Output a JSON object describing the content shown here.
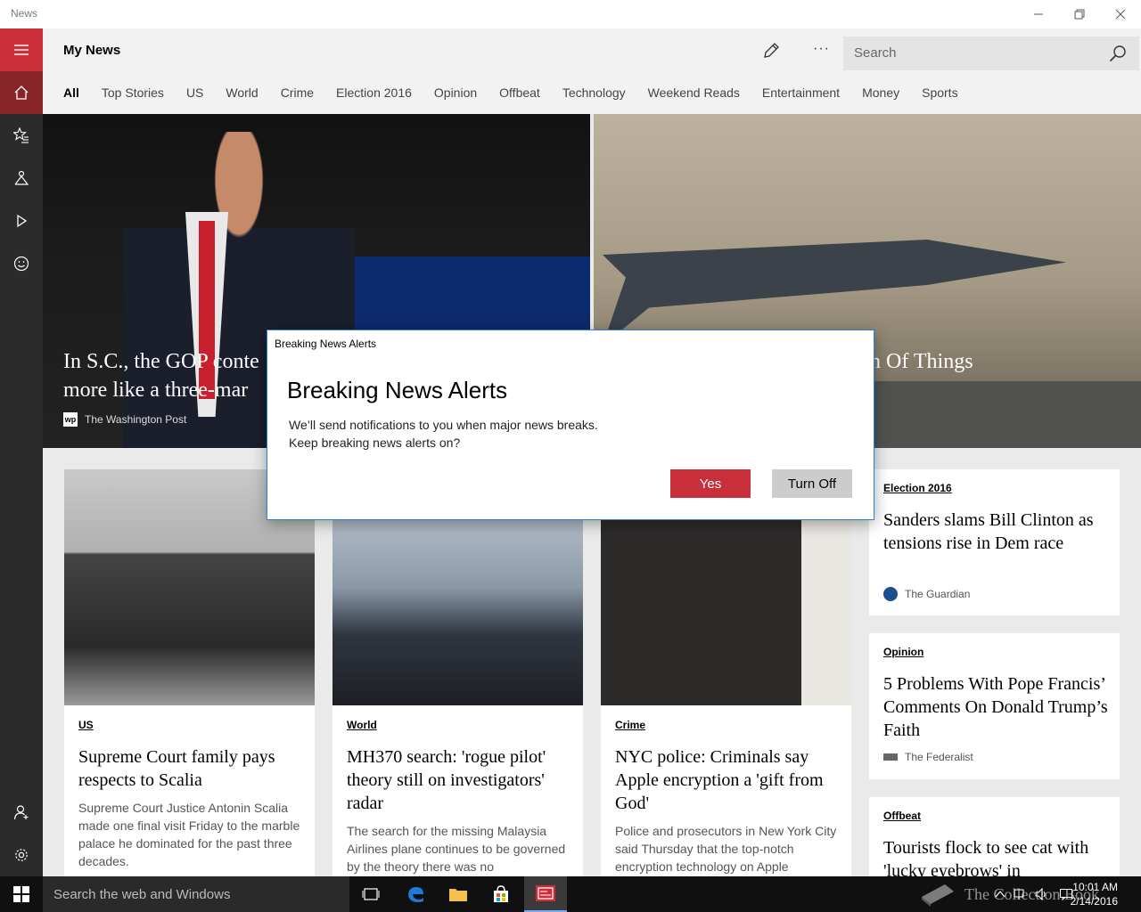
{
  "window": {
    "title": "News"
  },
  "header": {
    "title": "My News",
    "search_placeholder": "Search"
  },
  "tabs": [
    {
      "label": "All",
      "active": true
    },
    {
      "label": "Top Stories"
    },
    {
      "label": "US"
    },
    {
      "label": "World"
    },
    {
      "label": "Crime"
    },
    {
      "label": "Election 2016"
    },
    {
      "label": "Opinion"
    },
    {
      "label": "Offbeat"
    },
    {
      "label": "Technology"
    },
    {
      "label": "Weekend Reads"
    },
    {
      "label": "Entertainment"
    },
    {
      "label": "Money"
    },
    {
      "label": "Sports"
    }
  ],
  "rail": {
    "items": [
      "hamburger-icon",
      "home-icon",
      "favorites-icon",
      "interests-icon",
      "video-icon",
      "smiley-icon",
      "account-icon",
      "settings-icon"
    ]
  },
  "hero": {
    "left_headline_1": "In S.C., the GOP conte",
    "left_headline_2": "more like a three-mar",
    "left_source": "The Washington Post",
    "left_source_logo": "wp",
    "right_headline": "n Of Things"
  },
  "cards": {
    "us": {
      "category": "US",
      "headline": "Supreme Court family pays respects to Scalia",
      "summary": "Supreme Court Justice Antonin Scalia made one final visit Friday to the marble palace he dominated for the past three decades."
    },
    "world": {
      "category": "World",
      "headline": "MH370 search: 'rogue pilot' theory still on investigators' radar",
      "summary": "The search for the missing Malaysia Airlines plane continues to be governed by the theory there was no"
    },
    "crime": {
      "category": "Crime",
      "headline": "NYC police: Criminals say Apple encryption a 'gift from God'",
      "summary": "Police and prosecutors in New York City said Thursday that the top-notch encryption technology on Apple"
    },
    "election": {
      "category": "Election 2016",
      "headline": "Sanders slams Bill Clinton as tensions rise in Dem race",
      "source": "The Guardian"
    },
    "opinion": {
      "category": "Opinion",
      "headline": "5 Problems With Pope Francis’ Comments On Donald Trump’s Faith",
      "source": "The Federalist"
    },
    "offbeat": {
      "category": "Offbeat",
      "headline": "Tourists flock to see cat with 'lucky eyebrows' in"
    }
  },
  "dialog": {
    "window_title": "Breaking News Alerts",
    "title": "Breaking News Alerts",
    "line1": "We’ll send notifications to you when major news breaks.",
    "line2": "Keep breaking news alerts on?",
    "yes_label": "Yes",
    "off_label": "Turn Off"
  },
  "taskbar": {
    "search_placeholder": "Search the web and Windows",
    "time": "10:01 AM",
    "date": "2/14/2016",
    "watermark": "The Collection Book"
  },
  "colors": {
    "accent": "#c92f3a",
    "rail": "#2b2b2b",
    "dialog_border": "#2b7fd6"
  }
}
